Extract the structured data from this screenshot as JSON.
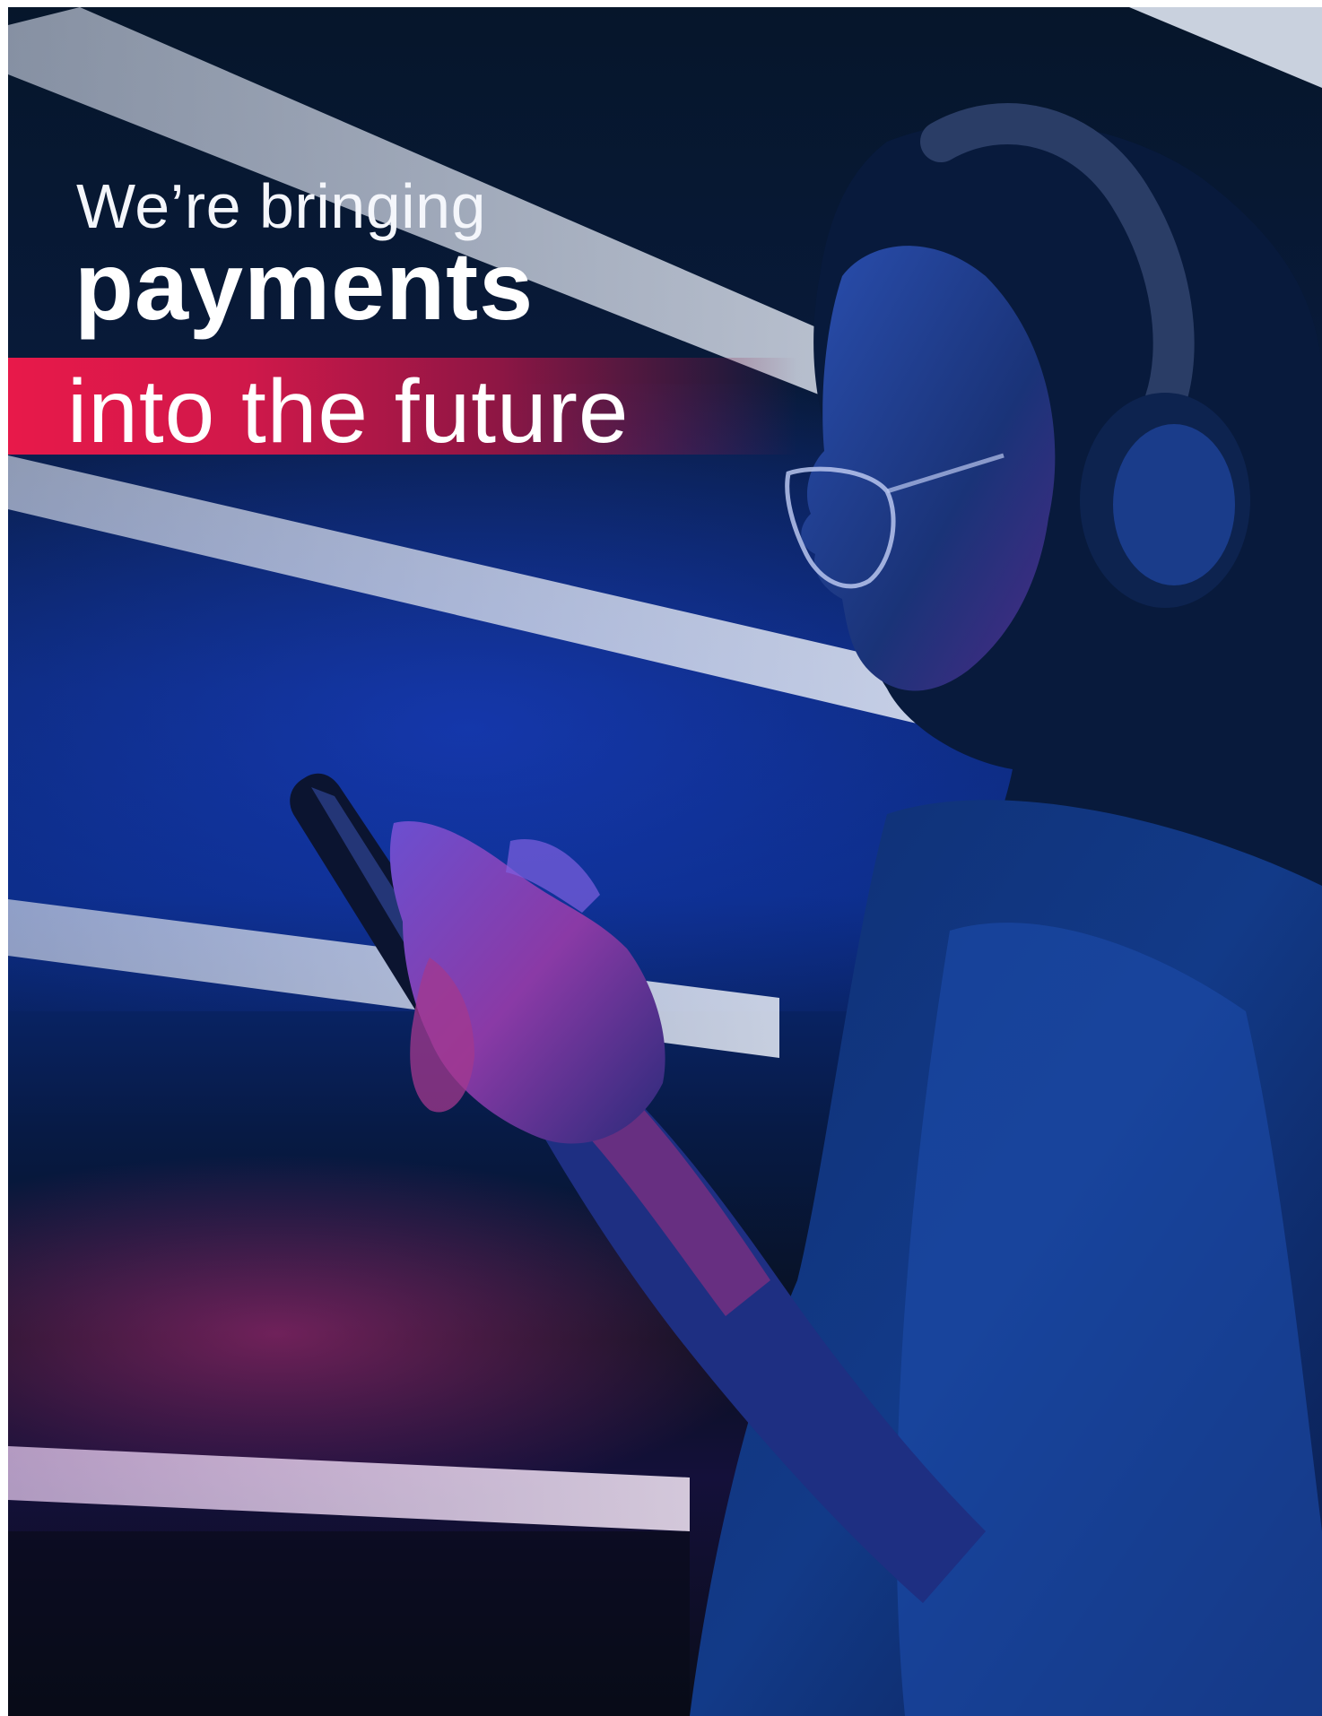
{
  "headline": {
    "line1": "We’re bringing",
    "line2": "payments",
    "line3": "into the future"
  },
  "colors": {
    "banner_red": "#e8194a",
    "background_navy": "#06162b",
    "neon_blue": "#1c44d8",
    "neon_magenta": "#c42f8a"
  }
}
